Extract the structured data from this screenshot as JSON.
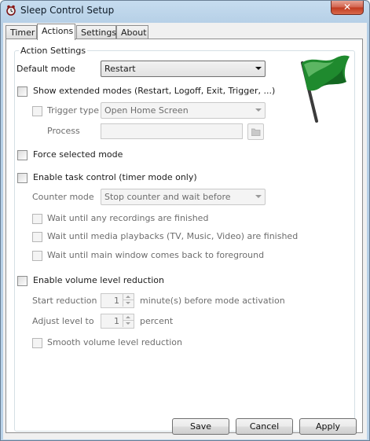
{
  "window": {
    "title": "Sleep Control Setup",
    "close_glyph": "✕"
  },
  "tabs": [
    "Timer",
    "Actions",
    "Settings",
    "About"
  ],
  "group": {
    "title": "Action Settings"
  },
  "default_mode": {
    "label": "Default mode",
    "value": "Restart"
  },
  "extended_modes": {
    "label": "Show extended modes (Restart, Logoff, Exit, Trigger, ...)",
    "checked": false
  },
  "trigger_type": {
    "label": "Trigger type",
    "value": "Open Home Screen",
    "checked": false
  },
  "process": {
    "label": "Process",
    "value": ""
  },
  "force_mode": {
    "label": "Force selected mode",
    "checked": false
  },
  "task_control": {
    "label": "Enable task control (timer mode only)",
    "checked": false
  },
  "counter_mode": {
    "label": "Counter mode",
    "value": "Stop counter and wait before"
  },
  "wait_options": [
    {
      "label": "Wait until any recordings are finished",
      "checked": false
    },
    {
      "label": "Wait until media playbacks (TV, Music, Video) are finished",
      "checked": false
    },
    {
      "label": "Wait until main window comes back to foreground",
      "checked": false
    }
  ],
  "volume": {
    "label": "Enable volume level reduction",
    "checked": false,
    "start_label": "Start reduction",
    "start_value": "1",
    "start_suffix": "minute(s) before mode activation",
    "adjust_label": "Adjust level to",
    "adjust_value": "1",
    "adjust_suffix": "percent",
    "smooth_label": "Smooth volume level reduction"
  },
  "buttons": {
    "save": "Save",
    "cancel": "Cancel",
    "apply": "Apply"
  },
  "icons": {
    "app": "sleep-control-app-icon",
    "flag": "green-flag-icon",
    "folder": "folder-icon"
  },
  "colors": {
    "flag_green": "#1f8a2e",
    "titlebar": "#c6dcef",
    "close_red": "#c0391e"
  }
}
